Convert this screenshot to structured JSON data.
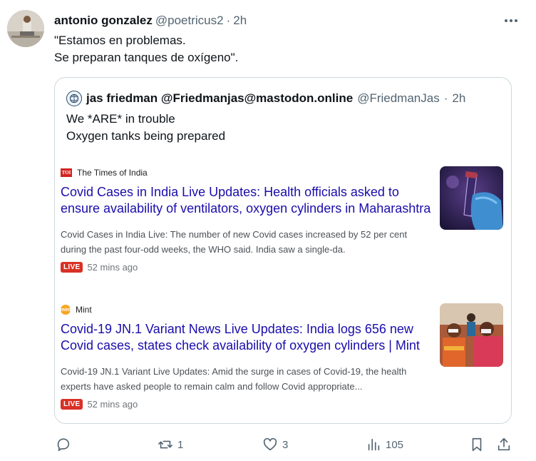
{
  "tweet": {
    "author": "antonio gonzalez",
    "handle": "@poetricus2",
    "separator": "·",
    "time": "2h",
    "text_line1": "\"Estamos en problemas.",
    "text_line2": "Se preparan tanques de oxígeno\"."
  },
  "quote": {
    "author": "jas friedman @Friedmanjas@mastodon.online",
    "handle": "@FriedmanJas",
    "separator": "·",
    "time": "2h",
    "text_line1": "We *ARE* in trouble",
    "text_line2": "Oxygen tanks being prepared",
    "articles": [
      {
        "source": "The Times of India",
        "source_logo": "TOI",
        "headline": "Covid Cases in India Live Updates: Health officials asked to ensure availability of ventilators, oxygen cylinders in Maharashtra",
        "snippet": "Covid Cases in India Live: The number of new Covid cases increased by 52 per cent during the past four-odd weeks, the WHO said. India saw a single-da.",
        "live_label": "LIVE",
        "age": "52 mins ago"
      },
      {
        "source": "Mint",
        "source_logo": "mint",
        "headline": "Covid-19 JN.1 Variant News Live Updates: India logs 656 new Covid cases, states check availability of oxygen cylinders | Mint",
        "snippet": "Covid-19 JN.1 Variant Live Updates: Amid the surge in cases of Covid-19, the health experts have asked people to remain calm and follow Covid appropriate...",
        "live_label": "LIVE",
        "age": "52 mins ago"
      }
    ]
  },
  "actions": {
    "reply_icon": "reply-icon",
    "retweet_icon": "retweet-icon",
    "retweet_count": "1",
    "like_icon": "heart-icon",
    "like_count": "3",
    "views_icon": "views-icon",
    "views_count": "105",
    "bookmark_icon": "bookmark-icon",
    "share_icon": "share-icon"
  },
  "colors": {
    "link": "#1a0dab",
    "muted": "#536471",
    "live": "#d93025",
    "border": "#cfd9de"
  }
}
